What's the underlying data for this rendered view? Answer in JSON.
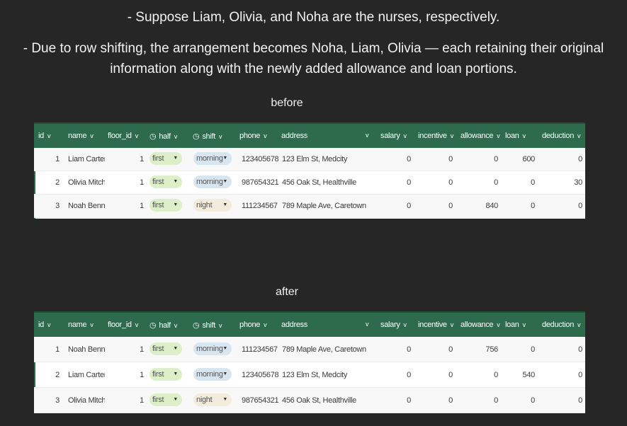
{
  "captions": {
    "line1": "- Suppose Liam, Olivia, and Noha are the nurses, respectively.",
    "line2": "- Due to row shifting, the arrangement becomes Noha, Liam, Olivia — each retaining their original information along with the newly added allowance and loan portions."
  },
  "labels": {
    "before": "before",
    "after": "after"
  },
  "columns": {
    "id": "id",
    "name": "name",
    "floor_id": "floor_id",
    "half": "half",
    "shift": "shift",
    "phone": "phone",
    "address": "address",
    "salary": "salary",
    "incentive": "incentive",
    "allowance": "allowance",
    "loan": "loan",
    "deduction": "deduction"
  },
  "icons": {
    "chevron": "v",
    "clock": "◷",
    "caret": "▼"
  },
  "before_rows": [
    {
      "id": "1",
      "name": "Liam Carter",
      "floor_id": "1",
      "half": "first",
      "shift": "morning",
      "phone": "123405678",
      "address": "123 Elm St, Medcity",
      "salary": "0",
      "incentive": "0",
      "allowance": "0",
      "loan": "600",
      "deduction": "0"
    },
    {
      "id": "2",
      "name": "Olivia Mitche",
      "floor_id": "1",
      "half": "first",
      "shift": "morning",
      "phone": "987654321",
      "address": "456 Oak St, Healthville",
      "salary": "0",
      "incentive": "0",
      "allowance": "0",
      "loan": "0",
      "deduction": "30"
    },
    {
      "id": "3",
      "name": "Noah Bennet",
      "floor_id": "1",
      "half": "first",
      "shift": "night",
      "phone": "111234567",
      "address": "789 Maple Ave, Caretown",
      "salary": "0",
      "incentive": "0",
      "allowance": "840",
      "loan": "0",
      "deduction": "0"
    }
  ],
  "after_rows": [
    {
      "id": "1",
      "name": "Noah Bennet",
      "floor_id": "1",
      "half": "first",
      "shift": "morning",
      "phone": "111234567",
      "address": "789 Maple Ave, Caretown",
      "salary": "0",
      "incentive": "0",
      "allowance": "756",
      "loan": "0",
      "deduction": "0"
    },
    {
      "id": "2",
      "name": "Liam Carter",
      "floor_id": "1",
      "half": "first",
      "shift": "morning",
      "phone": "123405678",
      "address": "123 Elm St, Medcity",
      "salary": "0",
      "incentive": "0",
      "allowance": "0",
      "loan": "540",
      "deduction": "0"
    },
    {
      "id": "3",
      "name": "Olivia Mitche",
      "floor_id": "1",
      "half": "first",
      "shift": "night",
      "phone": "987654321",
      "address": "456 Oak St, Healthville",
      "salary": "0",
      "incentive": "0",
      "allowance": "0",
      "loan": "0",
      "deduction": "0"
    }
  ],
  "colors": {
    "header": "#2d6b4c",
    "half_pill": "#dcefc9",
    "morning_pill": "#d8e6f2",
    "night_pill": "#f3ecdc"
  }
}
